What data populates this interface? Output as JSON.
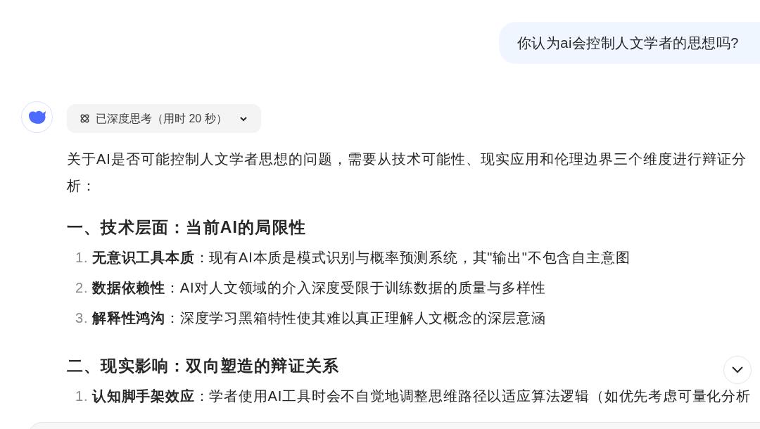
{
  "user_message": "你认为ai会控制人文学者的思想吗?",
  "thinking": {
    "label": "已深度思考（用时 20 秒）",
    "expanded": false
  },
  "answer": {
    "intro": "关于AI是否可能控制人文学者思想的问题，需要从技术可能性、现实应用和伦理边界三个维度进行辩证分析：",
    "sections": [
      {
        "heading": "一、技术层面：当前AI的局限性",
        "items": [
          {
            "number": "1.",
            "title": "无意识工具本质",
            "text": "：现有AI本质是模式识别与概率预测系统，其\"输出\"不包含自主意图"
          },
          {
            "number": "2.",
            "title": "数据依赖性",
            "text": "：AI对人文领域的介入深度受限于训练数据的质量与多样性"
          },
          {
            "number": "3.",
            "title": "解释性鸿沟",
            "text": "：深度学习黑箱特性使其难以真正理解人文概念的深层意涵"
          }
        ]
      },
      {
        "heading": "二、现实影响：双向塑造的辩证关系",
        "items": [
          {
            "number": "1.",
            "title": "认知脚手架效应",
            "text": "：学者使用AI工具时会不自觉地调整思维路径以适应算法逻辑（如优先考虑可量化分析"
          }
        ]
      }
    ]
  }
}
